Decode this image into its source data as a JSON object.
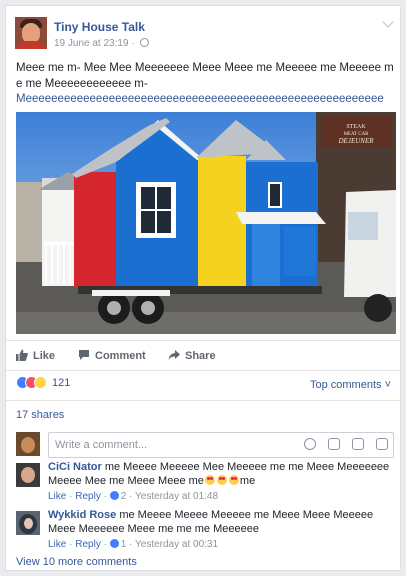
{
  "post": {
    "page_name": "Tiny House Talk",
    "timestamp": "19 June at 23:19 · ",
    "text_line1": "Meee me m- Mee Mee Meeeeeee Meee Meee me Meeeee me Meeeee me me Meeeeeeeeeeee m-",
    "text_line2": "Meeeeeeeeeeeeeeeeeeeeeeeeeeeeeeeeeeeeeeeeeeeeeeeeeeeeeeee",
    "sign_text1": "STEAK",
    "sign_text2": "MEAT CAR",
    "sign_text3": "DEJEUNER",
    "icons": [
      "globe-icon",
      "chevron-down-icon"
    ]
  },
  "actions": {
    "like_label": "Like",
    "comment_label": "Comment",
    "share_label": "Share"
  },
  "stats": {
    "reaction_count": "121",
    "top_comments_label": "Top comments ˅",
    "shares_label": "17 shares"
  },
  "composer": {
    "placeholder": "Write a comment..."
  },
  "comments": [
    {
      "name": "CiCi Nator",
      "text_before": " me Meeee Meeeee Mee Meeeee me me Meee Meeeeeee Meeee Mee me Meee Meee me",
      "text_after": "me",
      "like": "Like",
      "reply": "Reply",
      "sep": " · ",
      "likes": "2",
      "time": "Yesterday at 01:48"
    },
    {
      "name": "Wykkid Rose",
      "text_before": " me Meeee Meeee Meeeee me Meee Meee Meeeee Meee Meeeeee Meee me me me Meeeeee",
      "text_after": "",
      "like": "Like",
      "reply": "Reply",
      "sep": " · ",
      "likes": "1",
      "time": "Yesterday at 00:31"
    }
  ],
  "footer": {
    "view_more": "View 10 more comments"
  },
  "colors": {
    "link_blue": "#365899",
    "house_red": "#d4262c",
    "house_blue": "#1a6fd0",
    "house_yellow": "#f5d21e"
  }
}
